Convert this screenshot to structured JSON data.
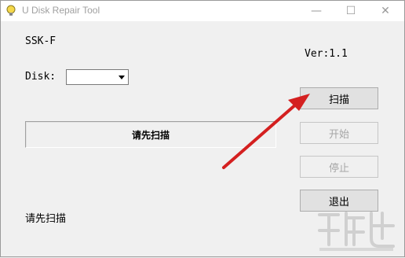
{
  "window": {
    "title": "U Disk Repair Tool"
  },
  "titlebar": {
    "minimize": "—",
    "maximize": "☐",
    "close": "✕"
  },
  "device": {
    "name": "SSK-F",
    "version": "Ver:1.1"
  },
  "disk": {
    "label": "Disk:",
    "selected": ""
  },
  "status": {
    "panel_text": "请先扫描",
    "bottom_text": "请先扫描"
  },
  "buttons": {
    "scan": "扫描",
    "start": "开始",
    "stop": "停止",
    "exit": "退出"
  },
  "colors": {
    "annotation_arrow": "#d42020",
    "disabled_text": "#a6a6a6"
  },
  "icons": {
    "app": "lightbulb-icon",
    "dropdown": "chevron-down-icon",
    "watermark": "logo-watermark"
  }
}
